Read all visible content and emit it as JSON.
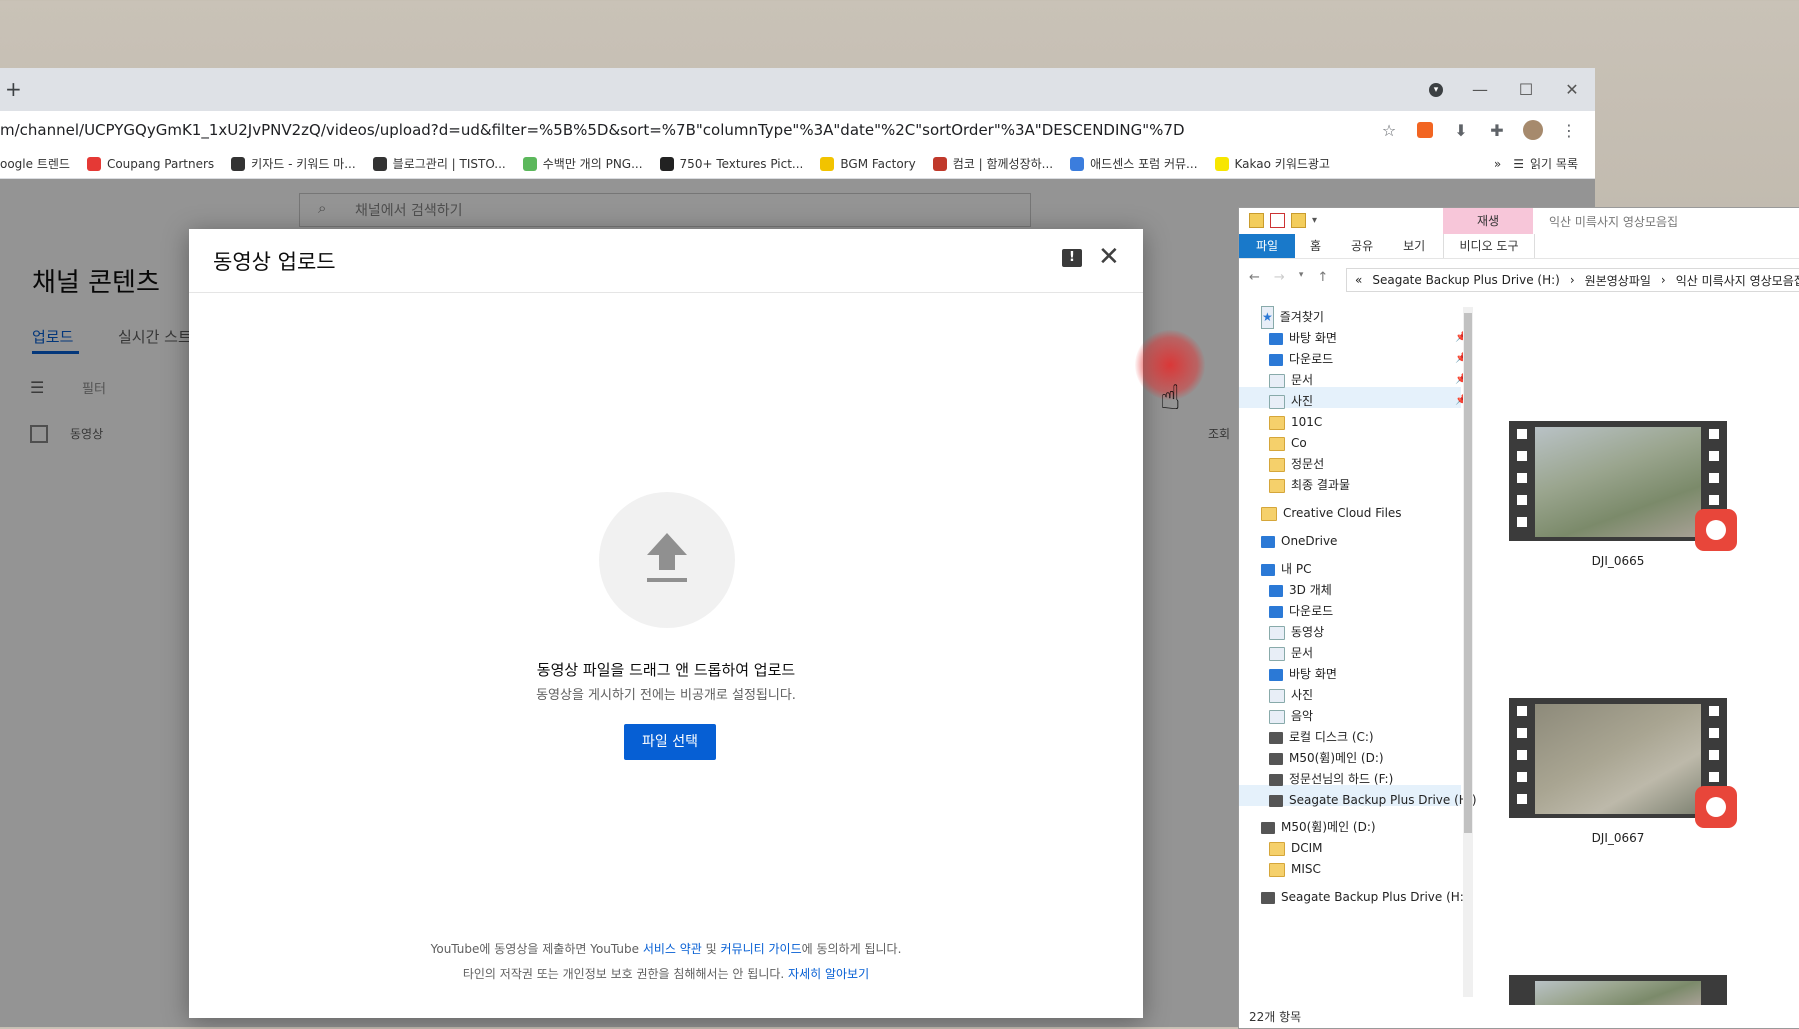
{
  "browser": {
    "new_tab": "+",
    "url": "m/channel/UCPYGQyGmK1_1xU2JvPNV2zQ/videos/upload?d=ud&filter=%5B%5D&sort=%7B\"columnType\"%3A\"date\"%2C\"sortOrder\"%3A\"DESCENDING\"%7D",
    "window_controls": {
      "minimize": "—",
      "maximize": "☐",
      "close": "✕"
    },
    "bookmarks": [
      {
        "label": "oogle 트렌드",
        "icon": "google-icon",
        "color": "#4285f4"
      },
      {
        "label": "Coupang Partners",
        "icon": "coupang-icon",
        "color": "#e53935"
      },
      {
        "label": "키자드 - 키워드 마...",
        "icon": "wand-icon",
        "color": "#333333"
      },
      {
        "label": "블로그관리 | TISTO...",
        "icon": "tistory-icon",
        "color": "#333333"
      },
      {
        "label": "수백만 개의 PNG...",
        "icon": "png-icon",
        "color": "#5cb85c"
      },
      {
        "label": "750+ Textures Pict...",
        "icon": "texture-icon",
        "color": "#222222"
      },
      {
        "label": "BGM Factory",
        "icon": "bgm-icon",
        "color": "#f2c300"
      },
      {
        "label": "컴코 | 함께성장하...",
        "icon": "comco-icon",
        "color": "#c0392b"
      },
      {
        "label": "애드센스 포럼 커뮤...",
        "icon": "adsense-icon",
        "color": "#3b7ddd"
      },
      {
        "label": "Kakao 키워드광고",
        "icon": "kakao-icon",
        "color": "#f7e600"
      }
    ],
    "bookmarks_more": "»",
    "reading_list": "읽기 목록"
  },
  "youtube": {
    "search_placeholder": "채널에서 검색하기",
    "page_title": "채널 콘텐츠",
    "tabs": [
      {
        "label": "업로드"
      },
      {
        "label": "실시간 스트"
      }
    ],
    "filter_label": "필터",
    "columns": {
      "video": "동영상",
      "views": "조회"
    }
  },
  "modal": {
    "title": "동영상 업로드",
    "drag_text": "동영상 파일을 드래그 앤 드롭하여 업로드",
    "private_note": "동영상을 게시하기 전에는 비공개로 설정됩니다.",
    "select_button": "파일 선택",
    "terms_prefix": "YouTube에 동영상을 제출하면 YouTube ",
    "terms_link1": "서비스 약관",
    "terms_and": " 및 ",
    "terms_link2": "커뮤니티 가이드",
    "terms_suffix": "에 동의하게 됩니다.",
    "terms2_text": "타인의 저작권 또는 개인정보 보호 권한을 침해해서는 안 됩니다. ",
    "terms2_link": "자세히 알아보기"
  },
  "explorer": {
    "context_tab": "재생",
    "window_title": "익산 미륵사지 영상모음집",
    "ribbon": {
      "file": "파일",
      "home": "홈",
      "share": "공유",
      "view": "보기",
      "video_tools": "비디오 도구"
    },
    "breadcrumbs": [
      "«",
      "Seagate Backup Plus Drive (H:)",
      "›",
      "원본영상파일",
      "›",
      "익산 미륵사지 영상모음집"
    ],
    "tree": {
      "quick_access": "즐겨찾기",
      "qa_items": [
        "바탕 화면",
        "다운로드",
        "문서",
        "사진",
        "101C",
        "Co",
        "정문선",
        "최종 결과물"
      ],
      "creative_cloud": "Creative Cloud Files",
      "onedrive": "OneDrive",
      "this_pc": "내 PC",
      "pc_items": [
        "3D 개체",
        "다운로드",
        "동영상",
        "문서",
        "바탕 화면",
        "사진",
        "음악",
        "로컬 디스크 (C:)",
        "M50(휨)메인 (D:)",
        "정문선님의 하드 (F:)",
        "Seagate Backup Plus Drive (H:)"
      ],
      "drive_d": "M50(휨)메인 (D:)",
      "drive_d_items": [
        "DCIM",
        "MISC"
      ],
      "drive_h": "Seagate Backup Plus Drive (H:)"
    },
    "files": [
      {
        "name": "DJI_0665"
      },
      {
        "name": "DJI_0667"
      }
    ],
    "status": "22개 항목"
  }
}
